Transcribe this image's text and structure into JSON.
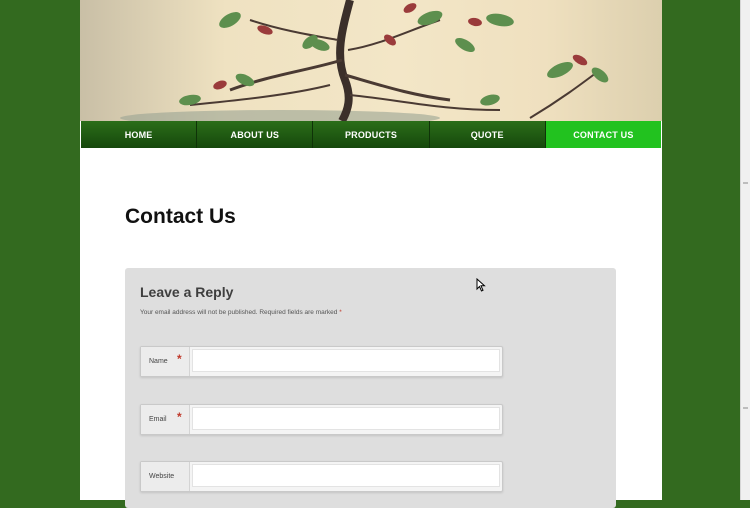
{
  "nav": {
    "items": [
      {
        "label": "HOME"
      },
      {
        "label": "ABOUT US"
      },
      {
        "label": "PRODUCTS"
      },
      {
        "label": "QUOTE"
      },
      {
        "label": "CONTACT US"
      }
    ],
    "active_index": 4
  },
  "page": {
    "title": "Contact Us"
  },
  "reply": {
    "title": "Leave a Reply",
    "notes": "Your email address will not be published. Required fields are marked",
    "required_marker": "*",
    "fields": [
      {
        "label": "Name",
        "required": true,
        "value": ""
      },
      {
        "label": "Email",
        "required": true,
        "value": ""
      },
      {
        "label": "Website",
        "required": false,
        "value": ""
      }
    ]
  },
  "colors": {
    "background": "#336a1f",
    "nav_active": "#22c21f",
    "required": "#c0392b"
  },
  "icons": [
    "mouse-cursor-icon"
  ]
}
